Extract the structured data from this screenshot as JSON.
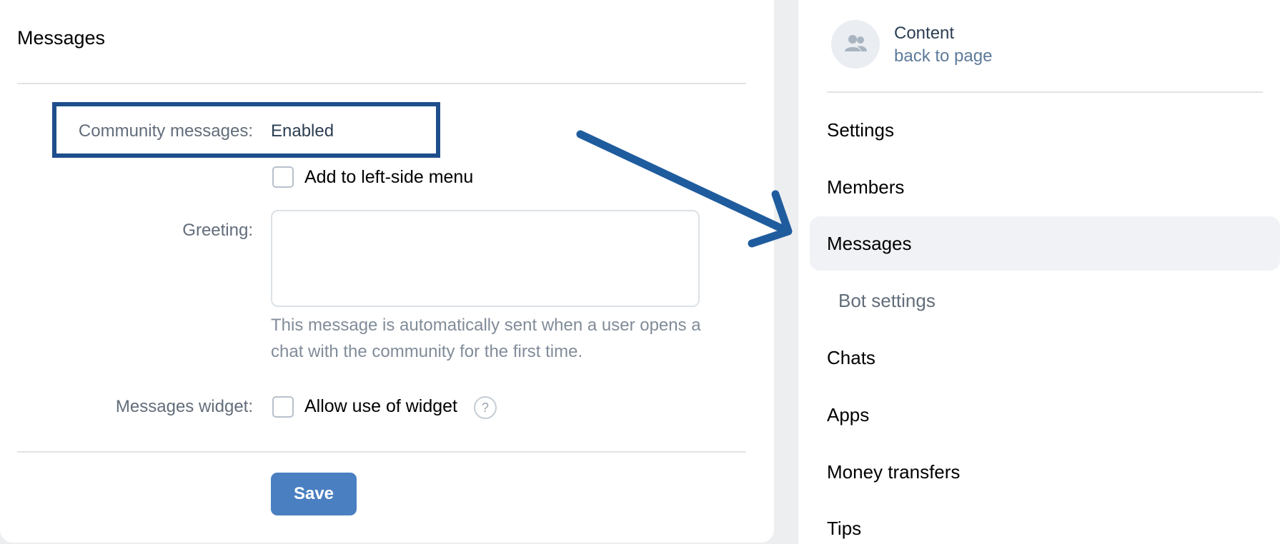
{
  "main": {
    "title": "Messages",
    "community_messages": {
      "label": "Community messages:",
      "value": "Enabled"
    },
    "left_menu": {
      "label": "Add to left-side menu",
      "checked": false
    },
    "greeting": {
      "label": "Greeting:",
      "value": "",
      "hint": "This message is automatically sent when a user opens a chat with the community for the first time."
    },
    "widget": {
      "label": "Messages widget:",
      "checkbox_label": "Allow use of widget",
      "checked": false,
      "help_icon": "?"
    },
    "save_label": "Save"
  },
  "nav": {
    "header": {
      "title": "Content",
      "subtitle": "back to page",
      "icon": "community-icon"
    },
    "items": [
      {
        "label": "Settings",
        "active": false
      },
      {
        "label": "Members",
        "active": false
      },
      {
        "label": "Messages",
        "active": true
      },
      {
        "label": "Bot settings",
        "active": false,
        "sub": true
      },
      {
        "label": "Chats",
        "active": false
      },
      {
        "label": "Apps",
        "active": false
      },
      {
        "label": "Money transfers",
        "active": false
      },
      {
        "label": "Tips",
        "active": false
      }
    ]
  },
  "annotation": {
    "box_color": "#1f4e8c",
    "arrow_color": "#1f5c9e"
  },
  "colors": {
    "accent": "#4a7fc1",
    "background": "#edeef0",
    "active_item": "#f0f2f5"
  }
}
